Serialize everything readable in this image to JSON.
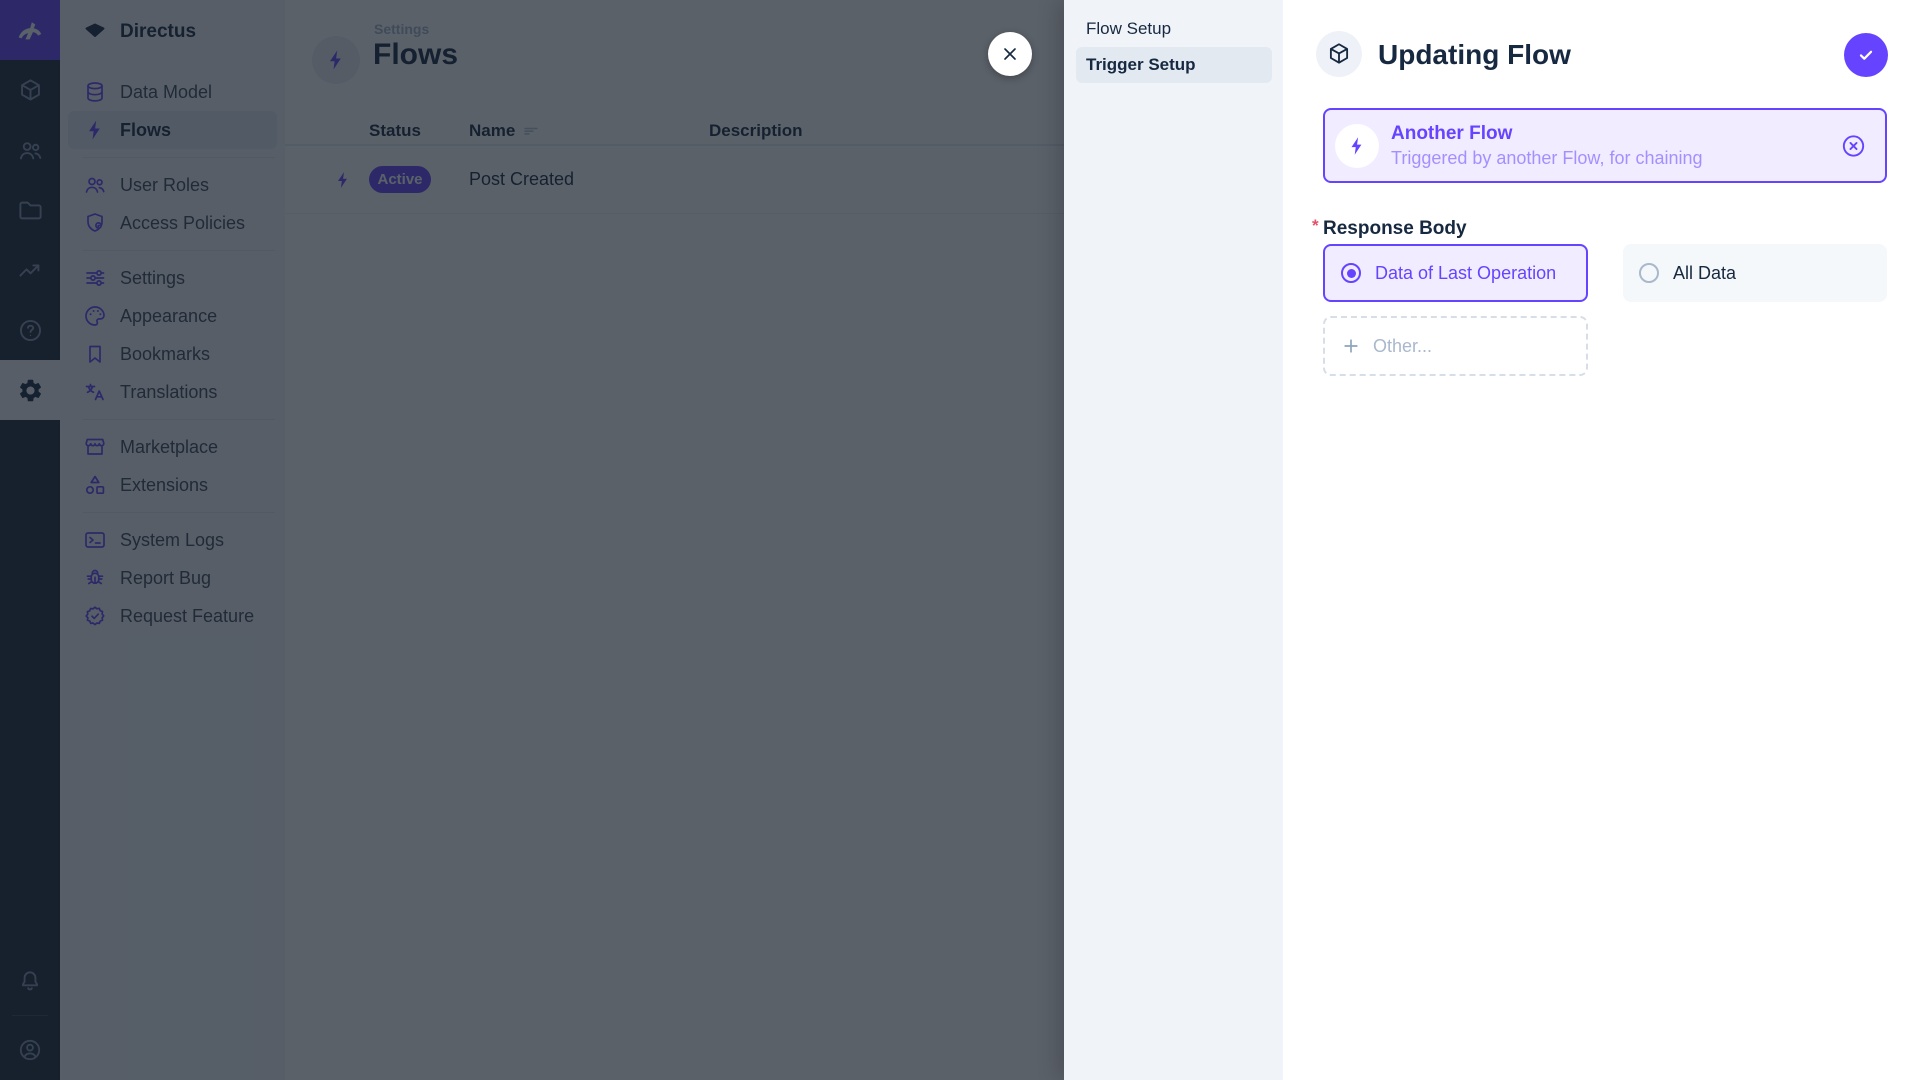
{
  "colors": {
    "primary": "#6644ff",
    "primary_light_bg": "#f1ecff",
    "module_bar_bg": "#1b2738",
    "sidebar_bg": "#f0f4f9",
    "text_dark": "#172940",
    "status_active_badge": "#6644ff",
    "overlay": "rgba(21,30,41,0.70)"
  },
  "module_bar": {
    "logo_icon": "directus-rabbit-logo",
    "modules": [
      {
        "icon": "cube-icon",
        "active": false
      },
      {
        "icon": "users-icon",
        "active": false
      },
      {
        "icon": "folder-icon",
        "active": false
      },
      {
        "icon": "insights-icon",
        "active": false
      },
      {
        "icon": "help-icon",
        "active": false
      },
      {
        "icon": "settings-gear-icon",
        "active": true
      }
    ],
    "bottom": [
      {
        "icon": "bell-icon"
      },
      {
        "icon": "account-circle-icon"
      }
    ]
  },
  "nav": {
    "project_name": "Directus",
    "project_icon": "gem-icon",
    "items": [
      {
        "label": "Data Model",
        "icon": "database-icon",
        "active": false
      },
      {
        "label": "Flows",
        "icon": "bolt-icon",
        "active": true
      },
      {
        "label": "User Roles",
        "icon": "users-icon",
        "active": false
      },
      {
        "label": "Access Policies",
        "icon": "shield-icon",
        "active": false
      },
      {
        "label": "Settings",
        "icon": "tune-icon",
        "active": false
      },
      {
        "label": "Appearance",
        "icon": "palette-icon",
        "active": false
      },
      {
        "label": "Bookmarks",
        "icon": "bookmark-icon",
        "active": false
      },
      {
        "label": "Translations",
        "icon": "translate-icon",
        "active": false
      },
      {
        "label": "Marketplace",
        "icon": "storefront-icon",
        "active": false
      },
      {
        "label": "Extensions",
        "icon": "extensions-icon",
        "active": false
      },
      {
        "label": "System Logs",
        "icon": "terminal-icon",
        "active": false
      },
      {
        "label": "Report Bug",
        "icon": "bug-icon",
        "active": false
      },
      {
        "label": "Request Feature",
        "icon": "feature-seal-icon",
        "active": false
      }
    ]
  },
  "main": {
    "breadcrumb": "Settings",
    "title": "Flows",
    "table": {
      "columns": {
        "status": "Status",
        "name": "Name",
        "description": "Description"
      },
      "rows": [
        {
          "status": "Active",
          "name": "Post Created",
          "description": ""
        }
      ]
    }
  },
  "drawer": {
    "sidebar": {
      "items": [
        {
          "label": "Flow Setup",
          "active": false
        },
        {
          "label": "Trigger Setup",
          "active": true
        }
      ]
    },
    "title": "Updating Flow",
    "trigger_card": {
      "title": "Another Flow",
      "subtitle": "Triggered by another Flow, for chaining"
    },
    "response_body": {
      "label": "Response Body",
      "required_marker": "*",
      "options": [
        {
          "label": "Data of Last Operation",
          "selected": true
        },
        {
          "label": "All Data",
          "selected": false
        }
      ],
      "other_label": "Other..."
    }
  }
}
